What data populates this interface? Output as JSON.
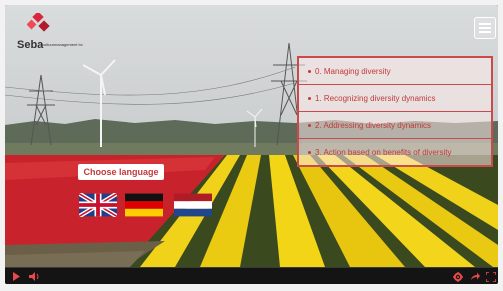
{
  "logo": {
    "name": "Seba",
    "tagline": "cultuurmanagement bv",
    "colors": [
      "#d7263d",
      "#ee4a55",
      "#b01c2e"
    ]
  },
  "menu_button": {
    "icon": "hamburger-icon"
  },
  "chapters": [
    {
      "label": "0. Managing diversity"
    },
    {
      "label": "1. Recognizing diversity dynamics"
    },
    {
      "label": "2. Addressing diversity dynamics"
    },
    {
      "label": "3. Action based on benefits of diversity"
    }
  ],
  "language": {
    "prompt": "Choose language",
    "flags": [
      {
        "name": "english-flag-icon"
      },
      {
        "name": "german-flag-icon"
      },
      {
        "name": "dutch-flag-icon"
      }
    ]
  },
  "controls": {
    "left": [
      "play-icon",
      "volume-icon"
    ],
    "right": [
      "settings-icon",
      "share-icon",
      "fullscreen-icon"
    ]
  },
  "colors": {
    "accent": "#c23a3a",
    "control_bar": "#141414"
  }
}
